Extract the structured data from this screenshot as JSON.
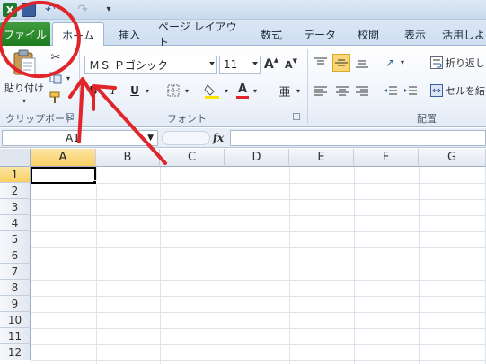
{
  "titlebar": {
    "qat": [
      "excel-logo-icon",
      "save-icon",
      "undo-icon",
      "redo-icon",
      "customize-qat-icon"
    ]
  },
  "tabs": {
    "file": "ファイル",
    "items": [
      "ホーム",
      "挿入",
      "ページ レイアウト",
      "数式",
      "データ",
      "校閲",
      "表示",
      "活用しよ"
    ]
  },
  "ribbon": {
    "clipboard": {
      "paste_label": "貼り付け",
      "group_label": "クリップボード"
    },
    "font": {
      "font_name": "ＭＳ Ｐゴシック",
      "font_size": "11",
      "bold": "B",
      "italic": "I",
      "underline": "U",
      "grow": "A",
      "shrink": "A",
      "font_color_glyph": "A",
      "phonetic_glyph": "亜",
      "group_label": "フォント"
    },
    "alignment": {
      "wrap_label": "折り返し",
      "merge_label": "セルを結",
      "group_label": "配置"
    }
  },
  "formula_bar": {
    "name_box": "A1",
    "fx": "fx",
    "value": ""
  },
  "sheet": {
    "columns": [
      "A",
      "B",
      "C",
      "D",
      "E",
      "F",
      "G"
    ],
    "rows": [
      "1",
      "2",
      "3",
      "4",
      "5",
      "6",
      "7",
      "8",
      "9",
      "10",
      "11",
      "12"
    ],
    "active_cell": "A1"
  },
  "annotation": {
    "color": "#e0262b"
  }
}
